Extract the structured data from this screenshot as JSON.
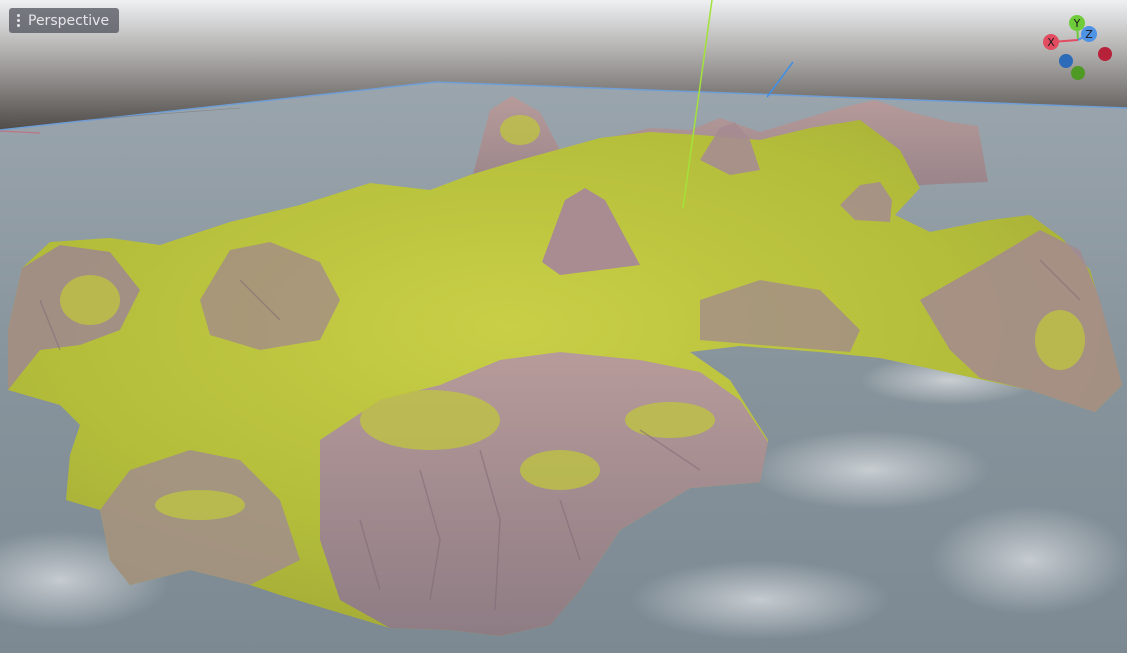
{
  "viewport": {
    "view_menu": {
      "icon": "kebab-menu-icon",
      "label": "Perspective"
    },
    "gizmo": {
      "axes": [
        {
          "label": "Y",
          "color": "#6ecc3a"
        },
        {
          "label": "Z",
          "color": "#4f93e6"
        },
        {
          "label": "X",
          "color": "#e24c61"
        }
      ]
    }
  },
  "scene": {
    "colors": {
      "sky": "#4e4b48",
      "water": "#8b979f",
      "grass": "#b9c23a",
      "rock": "#a58c8f",
      "y_axis_line": "#a3e23a",
      "z_axis_line": "#3f8fe8",
      "x_axis_line": "#e24c61"
    }
  }
}
